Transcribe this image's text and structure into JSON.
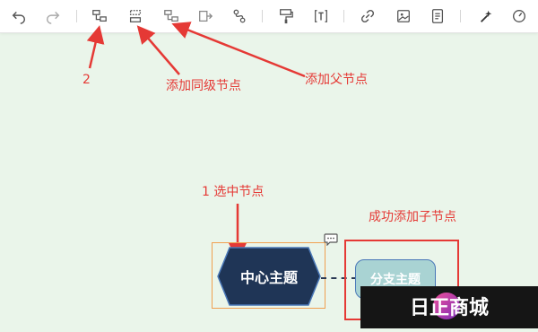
{
  "toolbar": {
    "buttons": [
      {
        "name": "undo-button",
        "icon": "undo-icon"
      },
      {
        "name": "redo-button",
        "icon": "redo-icon"
      },
      {
        "name": "add-child-node-button",
        "icon": "add-child-icon"
      },
      {
        "name": "add-sibling-node-button",
        "icon": "add-sibling-icon"
      },
      {
        "name": "add-parent-node-button",
        "icon": "add-parent-icon"
      },
      {
        "name": "move-node-button",
        "icon": "move-node-icon"
      },
      {
        "name": "relation-line-button",
        "icon": "relation-icon"
      },
      {
        "name": "format-brush-button",
        "icon": "format-brush-icon"
      },
      {
        "name": "text-button",
        "icon": "text-icon"
      },
      {
        "name": "link-button",
        "icon": "link-icon"
      },
      {
        "name": "image-button",
        "icon": "image-icon"
      },
      {
        "name": "note-button",
        "icon": "note-icon"
      },
      {
        "name": "magic-button",
        "icon": "magic-wand-icon"
      },
      {
        "name": "compass-button",
        "icon": "compass-icon"
      }
    ]
  },
  "annotations": {
    "step2": "2",
    "add_sibling": "添加同级节点",
    "add_parent": "添加父节点",
    "step1": "1 选中节点",
    "success": "成功添加子节点"
  },
  "mindmap": {
    "central_topic": "中心主题",
    "child_topic": "分支主题"
  },
  "watermark": {
    "text": "日正商城"
  },
  "colors": {
    "annotation": "#e53935",
    "central_fill": "#1f3556",
    "child_fill": "#a9d3d3",
    "selection": "#f0a050",
    "canvas": "#eaf5ea"
  }
}
